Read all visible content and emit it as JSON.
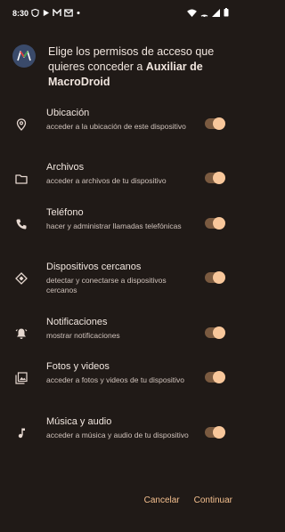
{
  "status_bar": {
    "time": "8:30",
    "notification_icons": [
      "shield-icon",
      "play-icon",
      "m-icon",
      "gmail-icon",
      "dot-icon"
    ],
    "right_icons": [
      "wifi-icon",
      "cast-icon",
      "signal-icon",
      "battery-icon"
    ]
  },
  "header": {
    "title_prefix": "Elige los permisos de acceso que quieres conceder a ",
    "app_name": "Auxiliar de MacroDroid"
  },
  "permissions": [
    {
      "icon": "location-icon",
      "name": "Ubicación",
      "description": "acceder a la ubicación de este dispositivo",
      "enabled": true
    },
    {
      "icon": "folder-icon",
      "name": "Archivos",
      "description": "acceder a archivos de tu dispositivo",
      "enabled": true
    },
    {
      "icon": "phone-icon",
      "name": "Teléfono",
      "description": "hacer y administrar llamadas telefónicas",
      "enabled": true
    },
    {
      "icon": "nearby-devices-icon",
      "name": "Dispositivos cercanos",
      "description": "detectar y conectarse a dispositivos cercanos",
      "enabled": true
    },
    {
      "icon": "bell-icon",
      "name": "Notificaciones",
      "description": "mostrar notificaciones",
      "enabled": true
    },
    {
      "icon": "photos-icon",
      "name": "Fotos y videos",
      "description": "acceder a fotos y videos de tu dispositivo",
      "enabled": true
    },
    {
      "icon": "music-note-icon",
      "name": "Música y audio",
      "description": "acceder a música y audio de tu dispositivo",
      "enabled": true
    }
  ],
  "actions": {
    "cancel_label": "Cancelar",
    "continue_label": "Continuar"
  },
  "colors": {
    "background": "#201a17",
    "accent": "#f5c08f"
  }
}
